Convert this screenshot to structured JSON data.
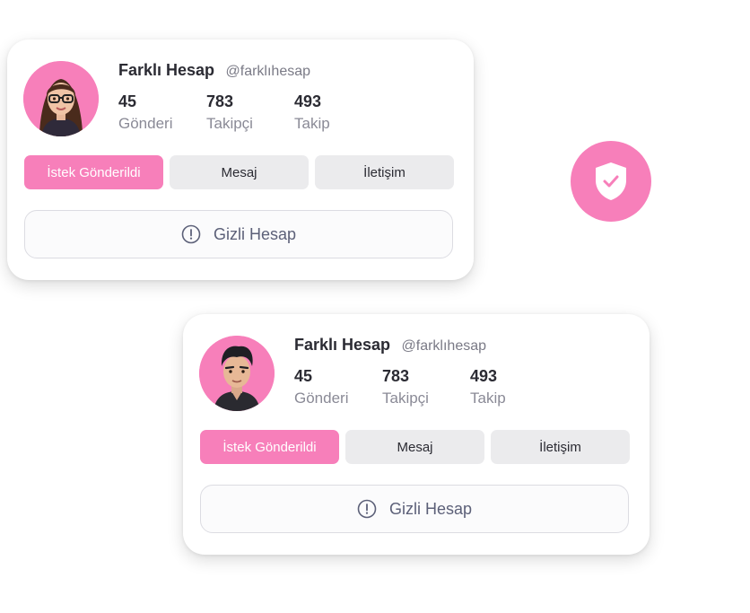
{
  "profiles": [
    {
      "name": "Farklı Hesap",
      "handle": "@farklıhesap",
      "stats": [
        {
          "value": "45",
          "label": "Gönderi"
        },
        {
          "value": "783",
          "label": "Takipçi"
        },
        {
          "value": "493",
          "label": "Takip"
        }
      ],
      "buttons": {
        "request": "İstek Gönderildi",
        "message": "Mesaj",
        "contact": "İletişim"
      },
      "private_label": "Gizli Hesap",
      "avatar_icon": "female-avatar-icon"
    },
    {
      "name": "Farklı Hesap",
      "handle": "@farklıhesap",
      "stats": [
        {
          "value": "45",
          "label": "Gönderi"
        },
        {
          "value": "783",
          "label": "Takipçi"
        },
        {
          "value": "493",
          "label": "Takip"
        }
      ],
      "buttons": {
        "request": "İstek Gönderildi",
        "message": "Mesaj",
        "contact": "İletişim"
      },
      "private_label": "Gizli Hesap",
      "avatar_icon": "male-avatar-icon"
    }
  ],
  "badge_icon": "shield-check-icon",
  "colors": {
    "accent": "#f77fba",
    "secondary_button": "#ebebed",
    "text_dark": "#2b2b33",
    "text_muted": "#8a8a96",
    "private_text": "#5c6078"
  }
}
